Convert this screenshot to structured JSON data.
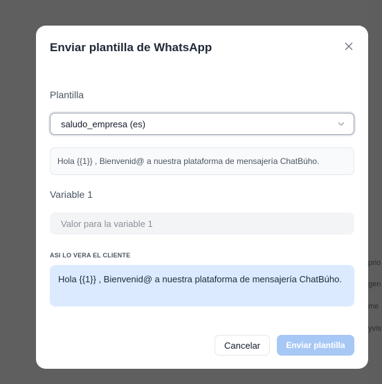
{
  "background": {
    "fragments": [
      "prio",
      "gen",
      "me",
      "yvis"
    ]
  },
  "modal": {
    "title": "Enviar plantilla de WhatsApp",
    "close_icon": "close-icon"
  },
  "template": {
    "label": "Plantilla",
    "selected": "saludo_empresa (es)",
    "preview_text": "Hola {{1}} , Bienvenid@ a nuestra plataforma de mensajería ChatBúho."
  },
  "variable": {
    "label": "Variable 1",
    "value": "",
    "placeholder": "Valor para la variable 1"
  },
  "client_preview": {
    "heading": "ASI LO VERA EL CLIENTE",
    "text": "Hola {{1}} , Bienvenid@ a nuestra plataforma de mensajería ChatBúho."
  },
  "actions": {
    "cancel_label": "Cancelar",
    "send_label": "Enviar plantilla"
  },
  "colors": {
    "overlay": "#5f5f5f",
    "preview_bg": "#dbeafe",
    "send_disabled": "#a7c8f5"
  }
}
